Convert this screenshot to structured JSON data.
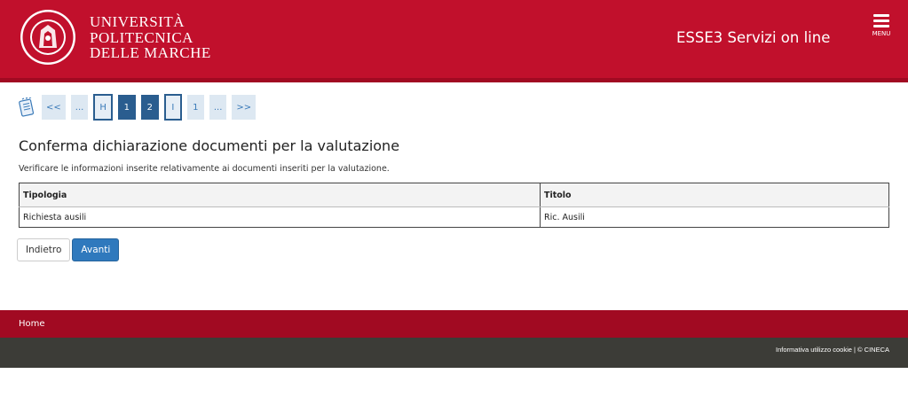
{
  "header": {
    "university_lines": [
      "UNIVERSITÀ",
      "POLITECNICA",
      "DELLE MARCHE"
    ],
    "service_title": "ESSE3 Servizi on line",
    "menu_label": "MENU",
    "brand_color": "#c1102c"
  },
  "trail": {
    "icon": "notepad-icon",
    "items": [
      "<<",
      "...",
      "H",
      "1",
      "2",
      "I",
      "1",
      "...",
      ">>"
    ]
  },
  "main": {
    "title": "Conferma dichiarazione documenti per la valutazione",
    "intro": "Verificare le informazioni inserite relativamente ai documenti inseriti per la valutazione.",
    "table": {
      "headers": [
        "Tipologia",
        "Titolo"
      ],
      "rows": [
        [
          "Richiesta ausili",
          "Ric. Ausili"
        ]
      ]
    },
    "buttons": {
      "back": "Indietro",
      "next": "Avanti"
    }
  },
  "footer": {
    "home": "Home",
    "cookie_link": "Informativa utilizzo cookie",
    "separator": " | ",
    "copyright": "© CINECA"
  }
}
